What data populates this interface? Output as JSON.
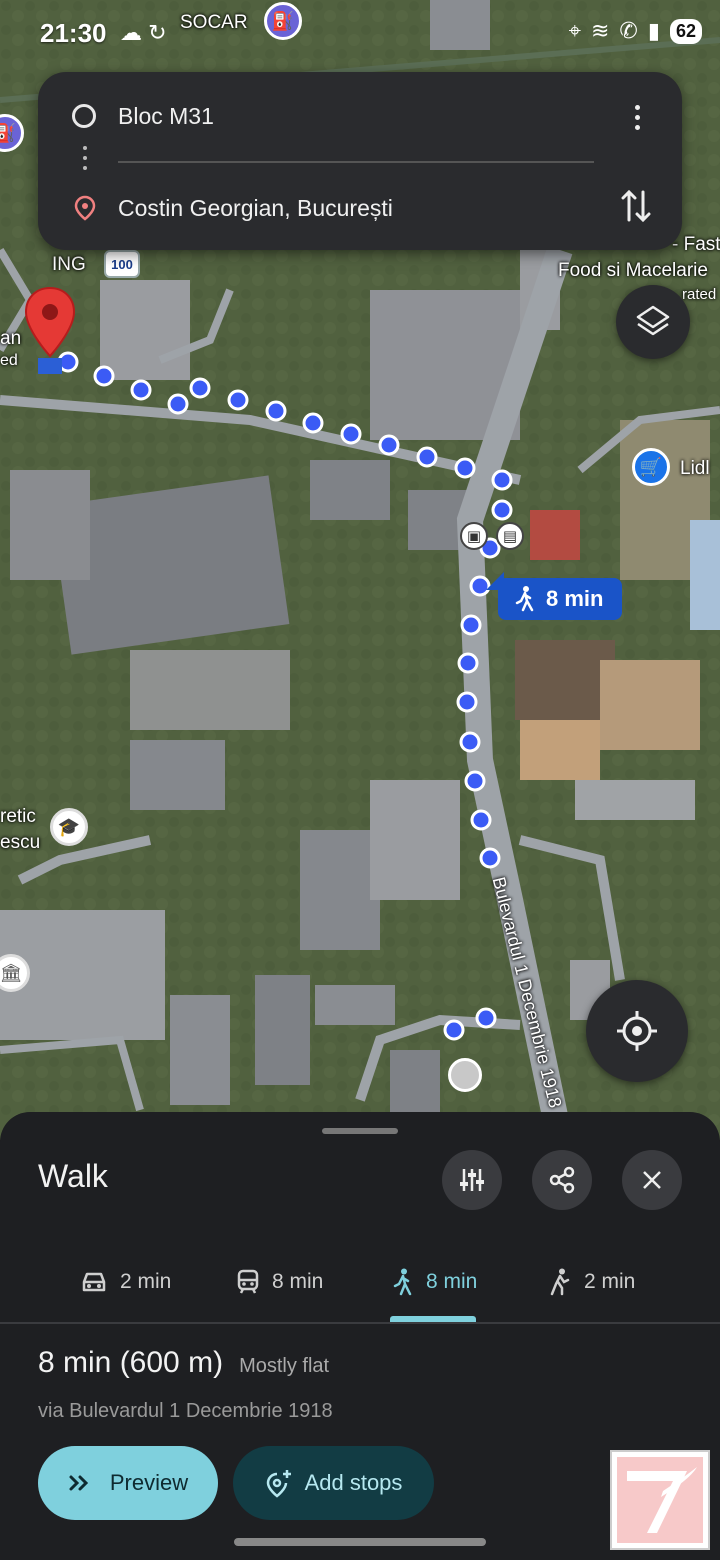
{
  "status_bar": {
    "time": "21:30",
    "battery": "62",
    "left_icons": [
      "cloud-icon",
      "sync-icon"
    ],
    "right_icons": [
      "location-icon",
      "wifi-icon",
      "call-icon",
      "signal-icon"
    ]
  },
  "route_card": {
    "origin": "Bloc M31",
    "destination": "Costin Georgian, București",
    "more_icon": "more-vert-icon",
    "swap_icon": "swap-icon"
  },
  "map": {
    "labels": {
      "socar": "SOCAR",
      "ing": "ING",
      "ing_badge": "100",
      "food": "Food si Macelarie",
      "fast": "- Fast",
      "rated": "rated",
      "lidl": "Lidl",
      "left_an": "an",
      "left_ed": "ed",
      "retic": "retic",
      "escu": "escu",
      "street": "Bulevardul 1 Decembrie 1918"
    },
    "walk_chip": "8 min",
    "colors": {
      "route_dot": "#3b5bf5",
      "pin": "#e53935",
      "walk_chip": "#1a54c8"
    }
  },
  "sheet": {
    "title": "Walk",
    "modes": [
      {
        "icon": "car-icon",
        "label": "2 min"
      },
      {
        "icon": "transit-icon",
        "label": "8 min"
      },
      {
        "icon": "walk-icon",
        "label": "8 min",
        "active": true
      },
      {
        "icon": "rideshare-icon",
        "label": "2 min"
      }
    ],
    "summary_main": "8 min (600 m)",
    "summary_sub": "Mostly flat",
    "via": "via Bulevardul 1 Decembrie 1918",
    "preview_label": "Preview",
    "add_stops_label": "Add stops",
    "accent": "#7fd0dd"
  }
}
